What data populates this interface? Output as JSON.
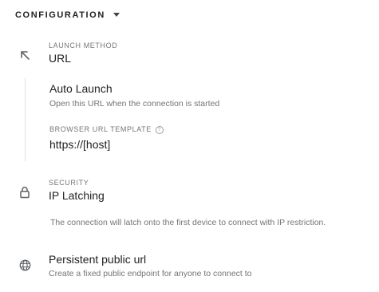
{
  "section": {
    "title": "CONFIGURATION",
    "toggle_icon": "caret-down-icon"
  },
  "launch": {
    "icon": "arrow-up-left-icon",
    "caption": "LAUNCH METHOD",
    "value": "URL",
    "auto_launch_title": "Auto Launch",
    "auto_launch_desc": "Open this URL when the connection is started",
    "template_caption": "BROWSER URL TEMPLATE",
    "template_help_icon": "help-icon",
    "template_value": "https://[host]"
  },
  "security": {
    "icon": "lock-icon",
    "caption": "SECURITY",
    "value": "IP Latching",
    "desc": "The connection will latch onto the first device to connect with IP restriction."
  },
  "public": {
    "icon": "globe-icon",
    "title": "Persistent public url",
    "desc": "Create a fixed public endpoint for anyone to connect to"
  }
}
